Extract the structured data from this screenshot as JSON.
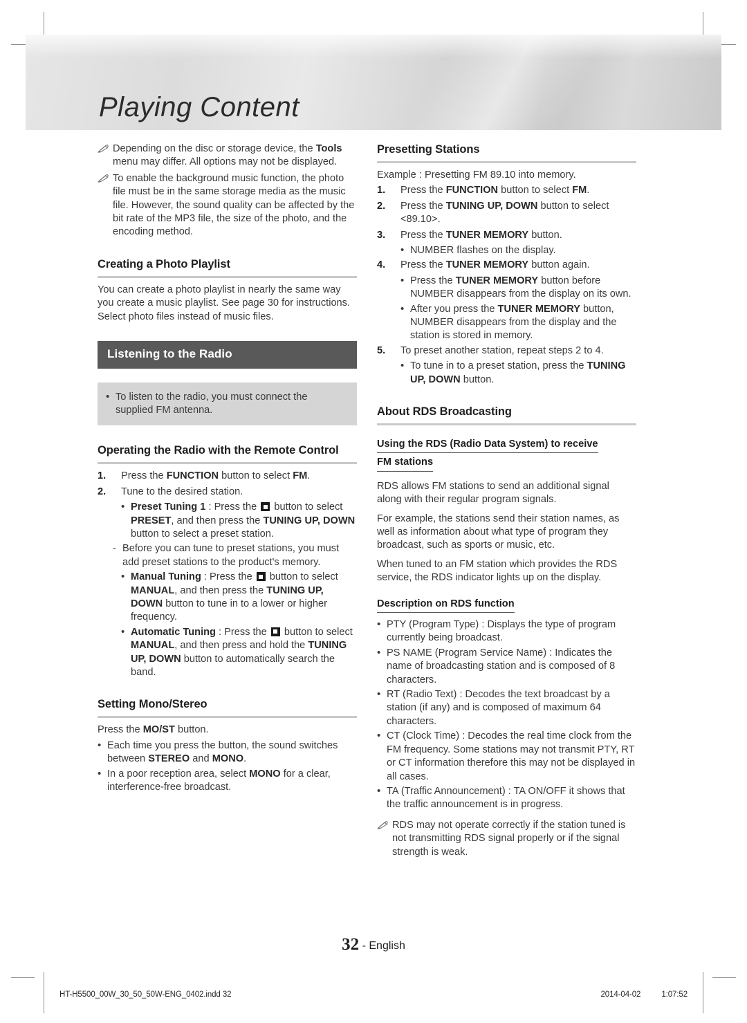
{
  "page": {
    "banner_title": "Playing Content",
    "footer_page_number": "32",
    "footer_language": "- English",
    "print_filename": "HT-H5500_00W_30_50_50W-ENG_0402.indd   32",
    "print_date": "2014-04-02",
    "print_time": "1:07:52",
    "accent_bar_color": "#595959",
    "tip_panel_color": "#d5d5d5",
    "rule_color": "#c9c9c9"
  },
  "left_column": {
    "notes": [
      {
        "pre": "Depending on the disc or storage device, the ",
        "bold": "Tools",
        "post": " menu may differ. All options may not be displayed."
      },
      {
        "pre": "To enable the background music function, the photo file must be in the same storage media as the music file. However, the sound quality can be affected by the bit rate of the MP3 file, the size of the photo, and the encoding method.",
        "bold": "",
        "post": ""
      }
    ],
    "creating_playlist": {
      "heading": "Creating a Photo Playlist",
      "body": "You can create a photo playlist in nearly the same way you create a music playlist. See page 30 for instructions. Select photo files instead of music files."
    },
    "section_bar": "Listening to the Radio",
    "tip": "To listen to the radio, you must connect the supplied FM antenna.",
    "operating_radio": {
      "heading": "Operating the Radio with the Remote Control",
      "step1_num": "1.",
      "step1_pre": "Press the ",
      "step1_b1": "FUNCTION",
      "step1_mid": " button to select ",
      "step1_b2": "FM",
      "step1_post": ".",
      "step2_num": "2.",
      "step2_text": "Tune to the desired station.",
      "preset": {
        "label": "Preset Tuning 1",
        "seg1": " : Press the ",
        "seg2": " button to select ",
        "b1": "PRESET",
        "seg3": ", and then press the ",
        "b2": "TUNING UP, DOWN",
        "seg4": " button to select a preset station."
      },
      "preset_sub": "Before you can tune to preset stations, you must add preset stations to the product's memory.",
      "manual": {
        "label": "Manual Tuning",
        "seg1": " : Press the ",
        "seg2": " button to select ",
        "b1": "MANUAL",
        "seg3": ", and then press the ",
        "b2": "TUNING UP, DOWN",
        "seg4": " button to tune in to a lower or higher frequency."
      },
      "automatic": {
        "label": "Automatic Tuning",
        "seg1": " : Press the ",
        "seg2": " button to select ",
        "b1": "MANUAL",
        "seg3": ", and then press and hold the ",
        "b2": "TUNING UP, DOWN",
        "seg4": " button to automatically search the band."
      }
    },
    "mono_stereo": {
      "heading": "Setting Mono/Stereo",
      "intro_pre": "Press the ",
      "intro_b": "MO/ST",
      "intro_post": " button.",
      "b1_pre": "Each time you press the button, the sound switches between ",
      "b1_b1": "STEREO",
      "b1_mid": " and ",
      "b1_b2": "MONO",
      "b1_post": ".",
      "b2_pre": "In a poor reception area, select ",
      "b2_b": "MONO",
      "b2_post": " for a clear, interference-free broadcast."
    }
  },
  "right_column": {
    "presetting": {
      "heading": "Presetting Stations",
      "example": "Example : Presetting FM 89.10 into memory.",
      "s1_num": "1.",
      "s1_pre": "Press the ",
      "s1_b1": "FUNCTION",
      "s1_mid": " button to select ",
      "s1_b2": "FM",
      "s1_post": ".",
      "s2_num": "2.",
      "s2_pre": "Press the ",
      "s2_b": "TUNING UP, DOWN",
      "s2_post": " button to select <89.10>.",
      "s3_num": "3.",
      "s3_pre": "Press the ",
      "s3_b": "TUNER MEMORY",
      "s3_post": " button.",
      "s3_bullet": "NUMBER flashes on the display.",
      "s4_num": "4.",
      "s4_pre": "Press the ",
      "s4_b": "TUNER MEMORY",
      "s4_post": " button again.",
      "s4_b1_pre": "Press the ",
      "s4_b1_b": "TUNER MEMORY",
      "s4_b1_post": " button before NUMBER disappears from the display on its own.",
      "s4_b2_pre": "After you press the ",
      "s4_b2_b": "TUNER MEMORY",
      "s4_b2_post": " button, NUMBER disappears from the display and the station is stored in memory.",
      "s5_num": "5.",
      "s5_text": "To preset another station, repeat steps 2 to 4.",
      "s5_bullet_pre": "To tune in to a preset station, press the ",
      "s5_bullet_b": "TUNING UP, DOWN",
      "s5_bullet_post": " button."
    },
    "rds": {
      "heading": "About RDS Broadcasting",
      "sub_head_line1": "Using the RDS (Radio Data System) to receive",
      "sub_head_line2": "FM stations",
      "para1": "RDS allows FM stations to send an additional signal along with their regular program signals.",
      "para2": "For example, the stations send their station names, as well as information about what type of program they broadcast, such as sports or music, etc.",
      "para3": "When tuned to an FM station which provides the RDS service, the RDS indicator lights up on the display.",
      "desc_heading": "Description on RDS function",
      "items": [
        "PTY (Program Type) : Displays the type of program currently being broadcast.",
        "PS NAME (Program Service Name) : Indicates the name of broadcasting station and is composed of 8 characters.",
        "RT (Radio Text) : Decodes the text broadcast by a station (if any) and is composed of maximum 64 characters.",
        "CT (Clock Time) : Decodes the real time clock from the FM frequency. Some stations may not transmit PTY, RT or CT information therefore this may not be displayed in all cases.",
        "TA (Traffic Announcement) : TA ON/OFF it shows that the traffic announcement is in progress."
      ],
      "note": "RDS may not operate correctly if the station tuned is not transmitting RDS signal properly or if the signal strength is weak."
    }
  }
}
